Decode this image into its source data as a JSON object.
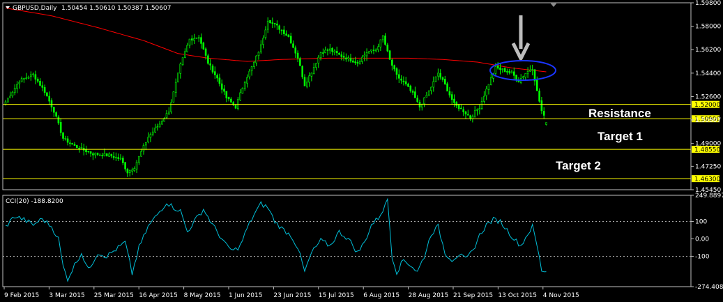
{
  "header": {
    "symbol": "GBPUSD,Daily",
    "ohlc": "1.50454 1.50610 1.50387 1.50607",
    "cci_label": "CCI(20) -188.8200"
  },
  "colors": {
    "background": "#000000",
    "candle": "#00ff00",
    "ma": "#ff0000",
    "cci": "#00bfd8",
    "level_line": "#ffff00",
    "level_label_bg": "#ffff00",
    "grid": "#c0c0c0",
    "ellipse": "#1a35ff"
  },
  "chart_data": [
    {
      "type": "candlestick",
      "title": "",
      "ylim": [
        1.4545,
        1.598
      ],
      "y_ticks": [
        "1.59800",
        "1.58000",
        "1.56200",
        "1.54400",
        "1.52600",
        "1.50807",
        "1.49000",
        "1.47250",
        "1.45450"
      ],
      "x_ticks": [
        "9 Feb 2015",
        "3 Mar 2015",
        "25 Mar 2015",
        "16 Apr 2015",
        "8 May 2015",
        "1 Jun 2015",
        "23 Jun 2015",
        "15 Jul 2015",
        "6 Aug 2015",
        "28 Aug 2015",
        "21 Sep 2015",
        "13 Oct 2015",
        "4 Nov 2015"
      ],
      "close_anchors": [
        [
          0,
          1.522
        ],
        [
          6,
          1.538
        ],
        [
          12,
          1.543
        ],
        [
          17,
          1.53
        ],
        [
          21,
          1.515
        ],
        [
          25,
          1.494
        ],
        [
          30,
          1.488
        ],
        [
          38,
          1.482
        ],
        [
          45,
          1.481
        ],
        [
          50,
          1.478
        ],
        [
          53,
          1.468
        ],
        [
          56,
          1.472
        ],
        [
          62,
          1.495
        ],
        [
          67,
          1.505
        ],
        [
          71,
          1.515
        ],
        [
          76,
          1.55
        ],
        [
          80,
          1.57
        ],
        [
          84,
          1.572
        ],
        [
          88,
          1.552
        ],
        [
          92,
          1.54
        ],
        [
          96,
          1.525
        ],
        [
          100,
          1.518
        ],
        [
          104,
          1.538
        ],
        [
          108,
          1.552
        ],
        [
          111,
          1.565
        ],
        [
          114,
          1.585
        ],
        [
          118,
          1.58
        ],
        [
          123,
          1.572
        ],
        [
          127,
          1.556
        ],
        [
          130,
          1.535
        ],
        [
          133,
          1.545
        ],
        [
          137,
          1.56
        ],
        [
          141,
          1.562
        ],
        [
          145,
          1.558
        ],
        [
          149,
          1.555
        ],
        [
          153,
          1.552
        ],
        [
          157,
          1.56
        ],
        [
          161,
          1.562
        ],
        [
          164,
          1.572
        ],
        [
          167,
          1.554
        ],
        [
          170,
          1.542
        ],
        [
          174,
          1.535
        ],
        [
          177,
          1.528
        ],
        [
          180,
          1.518
        ],
        [
          184,
          1.53
        ],
        [
          188,
          1.544
        ],
        [
          191,
          1.535
        ],
        [
          195,
          1.52
        ],
        [
          199,
          1.515
        ],
        [
          202,
          1.51
        ],
        [
          206,
          1.518
        ],
        [
          210,
          1.536
        ],
        [
          213,
          1.548
        ],
        [
          217,
          1.546
        ],
        [
          220,
          1.544
        ],
        [
          223,
          1.538
        ],
        [
          226,
          1.544
        ],
        [
          229,
          1.548
        ],
        [
          231,
          1.53
        ],
        [
          233,
          1.515
        ],
        [
          235,
          1.5061
        ]
      ],
      "ma_anchors": [
        [
          0,
          1.594
        ],
        [
          20,
          1.588
        ],
        [
          40,
          1.579
        ],
        [
          60,
          1.569
        ],
        [
          75,
          1.559
        ],
        [
          88,
          1.5555
        ],
        [
          105,
          1.553
        ],
        [
          120,
          1.5545
        ],
        [
          140,
          1.5555
        ],
        [
          160,
          1.5555
        ],
        [
          175,
          1.5555
        ],
        [
          190,
          1.5545
        ],
        [
          205,
          1.5525
        ],
        [
          220,
          1.548
        ],
        [
          235,
          1.545
        ]
      ],
      "levels": [
        {
          "value": 1.52,
          "label": "1.52000",
          "annotation": "Resistance"
        },
        {
          "value": 1.509,
          "label": "1.50900",
          "annotation": "Target 1"
        },
        {
          "value": 1.4855,
          "label": "1.48550",
          "annotation": ""
        },
        {
          "value": 1.463,
          "label": "1.46300",
          "annotation": "Target 2"
        }
      ]
    },
    {
      "type": "line",
      "title": "CCI(20) -188.8200",
      "ylim": [
        -274.4083,
        249.8897
      ],
      "y_ticks": [
        "249.8897",
        "100",
        "0.00",
        "-100",
        "-274.4083"
      ],
      "reference_lines": [
        100,
        -100
      ],
      "anchors": [
        [
          0,
          70
        ],
        [
          4,
          130
        ],
        [
          8,
          110
        ],
        [
          12,
          80
        ],
        [
          16,
          115
        ],
        [
          20,
          70
        ],
        [
          23,
          0
        ],
        [
          25,
          -160
        ],
        [
          27,
          -230
        ],
        [
          30,
          -150
        ],
        [
          33,
          -80
        ],
        [
          36,
          -180
        ],
        [
          40,
          -80
        ],
        [
          44,
          -100
        ],
        [
          48,
          -60
        ],
        [
          52,
          -20
        ],
        [
          55,
          -200
        ],
        [
          58,
          -50
        ],
        [
          62,
          70
        ],
        [
          66,
          140
        ],
        [
          70,
          210
        ],
        [
          73,
          180
        ],
        [
          76,
          160
        ],
        [
          79,
          40
        ],
        [
          82,
          100
        ],
        [
          86,
          170
        ],
        [
          90,
          80
        ],
        [
          93,
          20
        ],
        [
          96,
          -40
        ],
        [
          99,
          -70
        ],
        [
          102,
          -40
        ],
        [
          105,
          60
        ],
        [
          108,
          140
        ],
        [
          111,
          200
        ],
        [
          114,
          180
        ],
        [
          117,
          100
        ],
        [
          120,
          60
        ],
        [
          124,
          20
        ],
        [
          127,
          -50
        ],
        [
          130,
          -190
        ],
        [
          133,
          -80
        ],
        [
          137,
          -10
        ],
        [
          141,
          -40
        ],
        [
          145,
          40
        ],
        [
          149,
          0
        ],
        [
          153,
          -80
        ],
        [
          156,
          -20
        ],
        [
          159,
          80
        ],
        [
          162,
          120
        ],
        [
          165,
          190
        ],
        [
          166,
          230
        ],
        [
          168,
          -100
        ],
        [
          170,
          -190
        ],
        [
          173,
          -120
        ],
        [
          176,
          -150
        ],
        [
          179,
          -190
        ],
        [
          182,
          -100
        ],
        [
          185,
          30
        ],
        [
          188,
          70
        ],
        [
          191,
          -80
        ],
        [
          194,
          -120
        ],
        [
          197,
          -90
        ],
        [
          200,
          -120
        ],
        [
          203,
          -70
        ],
        [
          206,
          20
        ],
        [
          209,
          80
        ],
        [
          212,
          110
        ],
        [
          215,
          100
        ],
        [
          218,
          50
        ],
        [
          221,
          0
        ],
        [
          224,
          -40
        ],
        [
          227,
          30
        ],
        [
          229,
          70
        ],
        [
          231,
          -40
        ],
        [
          233,
          -180
        ],
        [
          235,
          -188.82
        ]
      ]
    }
  ]
}
